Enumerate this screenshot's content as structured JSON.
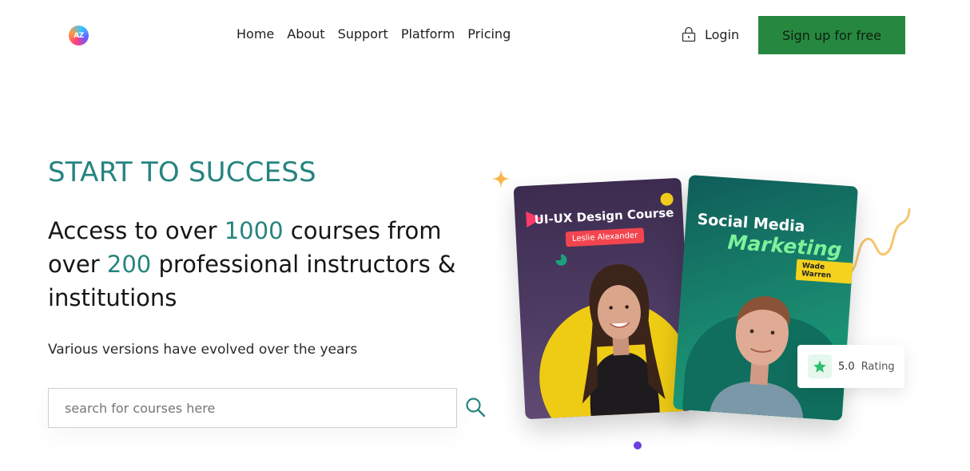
{
  "header": {
    "logo_text": "AZ",
    "nav": [
      "Home",
      "About",
      "Support",
      "Platform",
      "Pricing"
    ],
    "login_label": "Login",
    "signup_label": "Sign up for free"
  },
  "hero": {
    "eyebrow": "START TO SUCCESS",
    "headline": {
      "part1": "Access to over ",
      "highlight1": "1000",
      "part2": " courses from over ",
      "highlight2": "200",
      "part3": " professional instructors & institutions"
    },
    "subheading": "Various versions have evolved over the years",
    "search": {
      "placeholder": "search for courses here"
    }
  },
  "cards": [
    {
      "title": "UI-UX Design Course",
      "instructor": "Leslie Alexander"
    },
    {
      "title_line1": "Social Media",
      "title_line2": "Marketing",
      "instructor": "Wade Warren"
    }
  ],
  "rating": {
    "value": "5.0",
    "label": "Rating"
  },
  "colors": {
    "accent": "#26847f",
    "signup_bg": "#26883f",
    "pager_dot": "#6c3ee0"
  },
  "icons": {
    "lock": "lock-icon",
    "search": "search-icon",
    "star": "star-icon",
    "sparkle": "sparkle-icon"
  }
}
